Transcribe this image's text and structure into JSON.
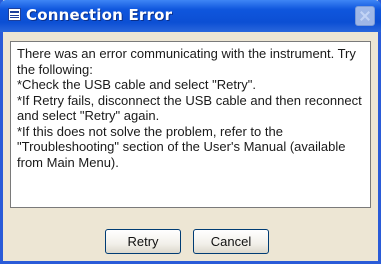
{
  "dialog": {
    "title": "Connection Error",
    "message_lines": [
      "There was an error communicating with the instrument. Try",
      "the following:",
      "*Check the USB cable and select \"Retry\".",
      "*If Retry fails, disconnect the USB cable and then reconnect",
      "and select \"Retry\" again.",
      "*If this does not solve the problem, refer to the",
      "\"Troubleshooting\" section of the User's Manual (available",
      "from Main Menu)."
    ],
    "buttons": {
      "retry": "Retry",
      "cancel": "Cancel"
    }
  },
  "icons": {
    "title_icon": "window-icon",
    "close_icon": "close-icon"
  },
  "colors": {
    "titlebar": "#0f56dd",
    "window_body": "#ede6d4",
    "message_bg": "#ffffff"
  }
}
